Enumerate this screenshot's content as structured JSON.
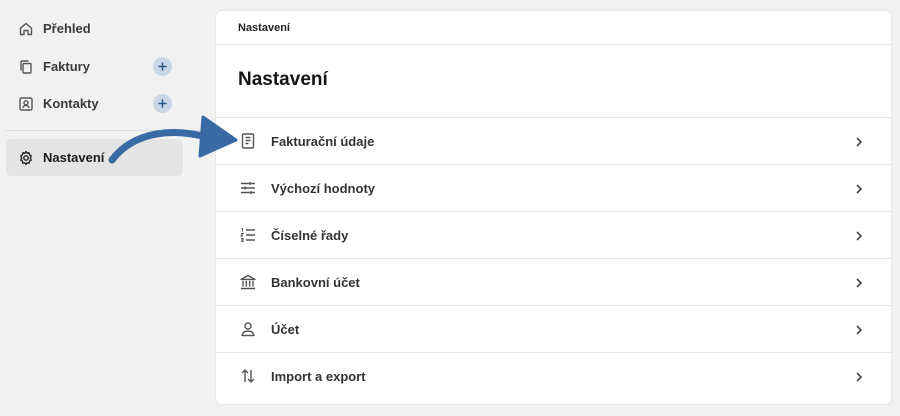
{
  "sidebar": {
    "items": [
      {
        "label": "Přehled",
        "icon": "home-icon"
      },
      {
        "label": "Faktury",
        "icon": "documents-icon"
      },
      {
        "label": "Kontakty",
        "icon": "contact-card-icon"
      },
      {
        "label": "Nastavení",
        "icon": "gear-icon"
      }
    ]
  },
  "main": {
    "breadcrumb": "Nastavení",
    "title": "Nastavení",
    "rows": [
      {
        "label": "Fakturační údaje",
        "icon": "receipt-icon"
      },
      {
        "label": "Výchozí hodnoty",
        "icon": "sliders-icon"
      },
      {
        "label": "Číselné řady",
        "icon": "numbered-list-icon"
      },
      {
        "label": "Bankovní účet",
        "icon": "bank-icon"
      },
      {
        "label": "Účet",
        "icon": "user-icon"
      },
      {
        "label": "Import a export",
        "icon": "swap-arrows-icon"
      }
    ]
  },
  "colors": {
    "background": "#f1f1f1",
    "active_item": "#e4e4e4",
    "plus_badge": "#c9d6e6",
    "annotation_arrow": "#3a6aa6"
  }
}
